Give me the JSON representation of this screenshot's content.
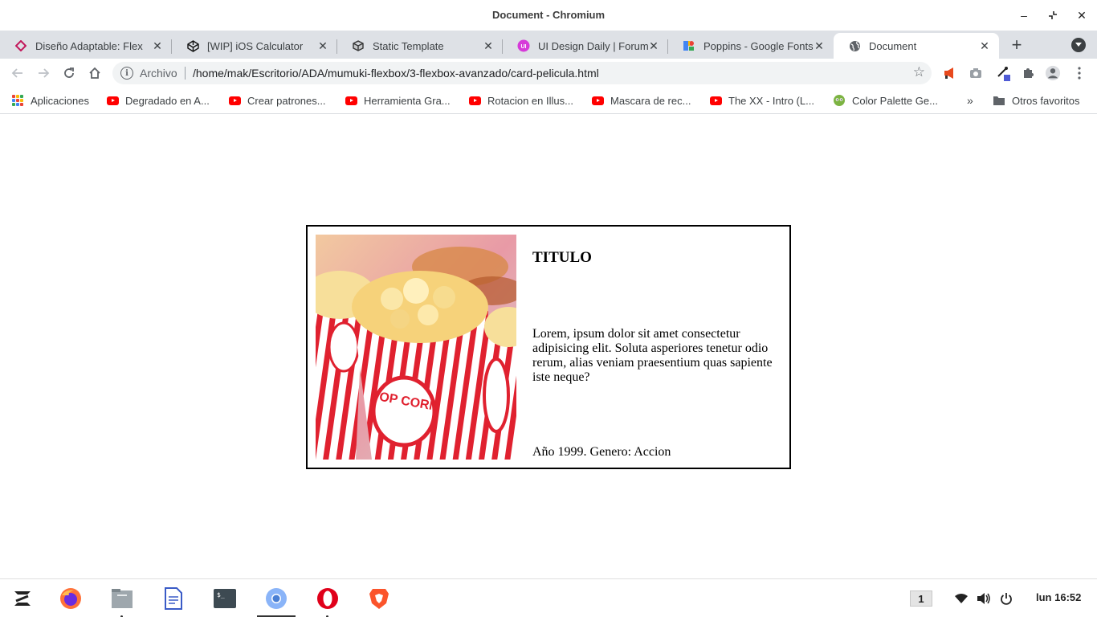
{
  "window": {
    "title": "Document - Chromium"
  },
  "tabs": [
    {
      "title": "Diseño Adaptable: Flex",
      "icon": "platzi-icon",
      "active": false
    },
    {
      "title": "[WIP] iOS Calculator",
      "icon": "codepen-icon",
      "active": false
    },
    {
      "title": "Static Template",
      "icon": "codesandbox-icon",
      "active": false
    },
    {
      "title": "UI Design Daily | Forum",
      "icon": "uidesigndaily-icon",
      "active": false
    },
    {
      "title": "Poppins - Google Fonts",
      "icon": "google-fonts-icon",
      "active": false
    },
    {
      "title": "Document",
      "icon": "globe-icon",
      "active": true
    }
  ],
  "omnibox": {
    "scheme_label": "Archivo",
    "url": "/home/mak/Escritorio/ADA/mumuki-flexbox/3-flexbox-avanzado/card-pelicula.html"
  },
  "bookmarks": {
    "apps_label": "Aplicaciones",
    "items": [
      {
        "label": "Degradado en A..."
      },
      {
        "label": "Crear patrones..."
      },
      {
        "label": "Herramienta Gra..."
      },
      {
        "label": "Rotacion en Illus..."
      },
      {
        "label": "Mascara de rec..."
      },
      {
        "label": "The XX - Intro (L..."
      },
      {
        "label": "Color Palette Ge..."
      }
    ],
    "overflow": "»",
    "other_label": "Otros favoritos"
  },
  "card": {
    "title": "TITULO",
    "description": "Lorem, ipsum dolor sit amet consectetur adipisicing elit. Soluta asperiores tenetur odio rerum, alias veniam praesentium quas sapiente iste neque?",
    "meta": "Año 1999. Genero: Accion",
    "poster_text": "POP CORN"
  },
  "taskbar": {
    "workspace": "1",
    "clock": "lun 16:52"
  },
  "colors": {
    "tabstrip_bg": "#dee1e6",
    "youtube_red": "#ff0000",
    "popcorn_red": "#e0212f",
    "card_border": "#000000"
  }
}
